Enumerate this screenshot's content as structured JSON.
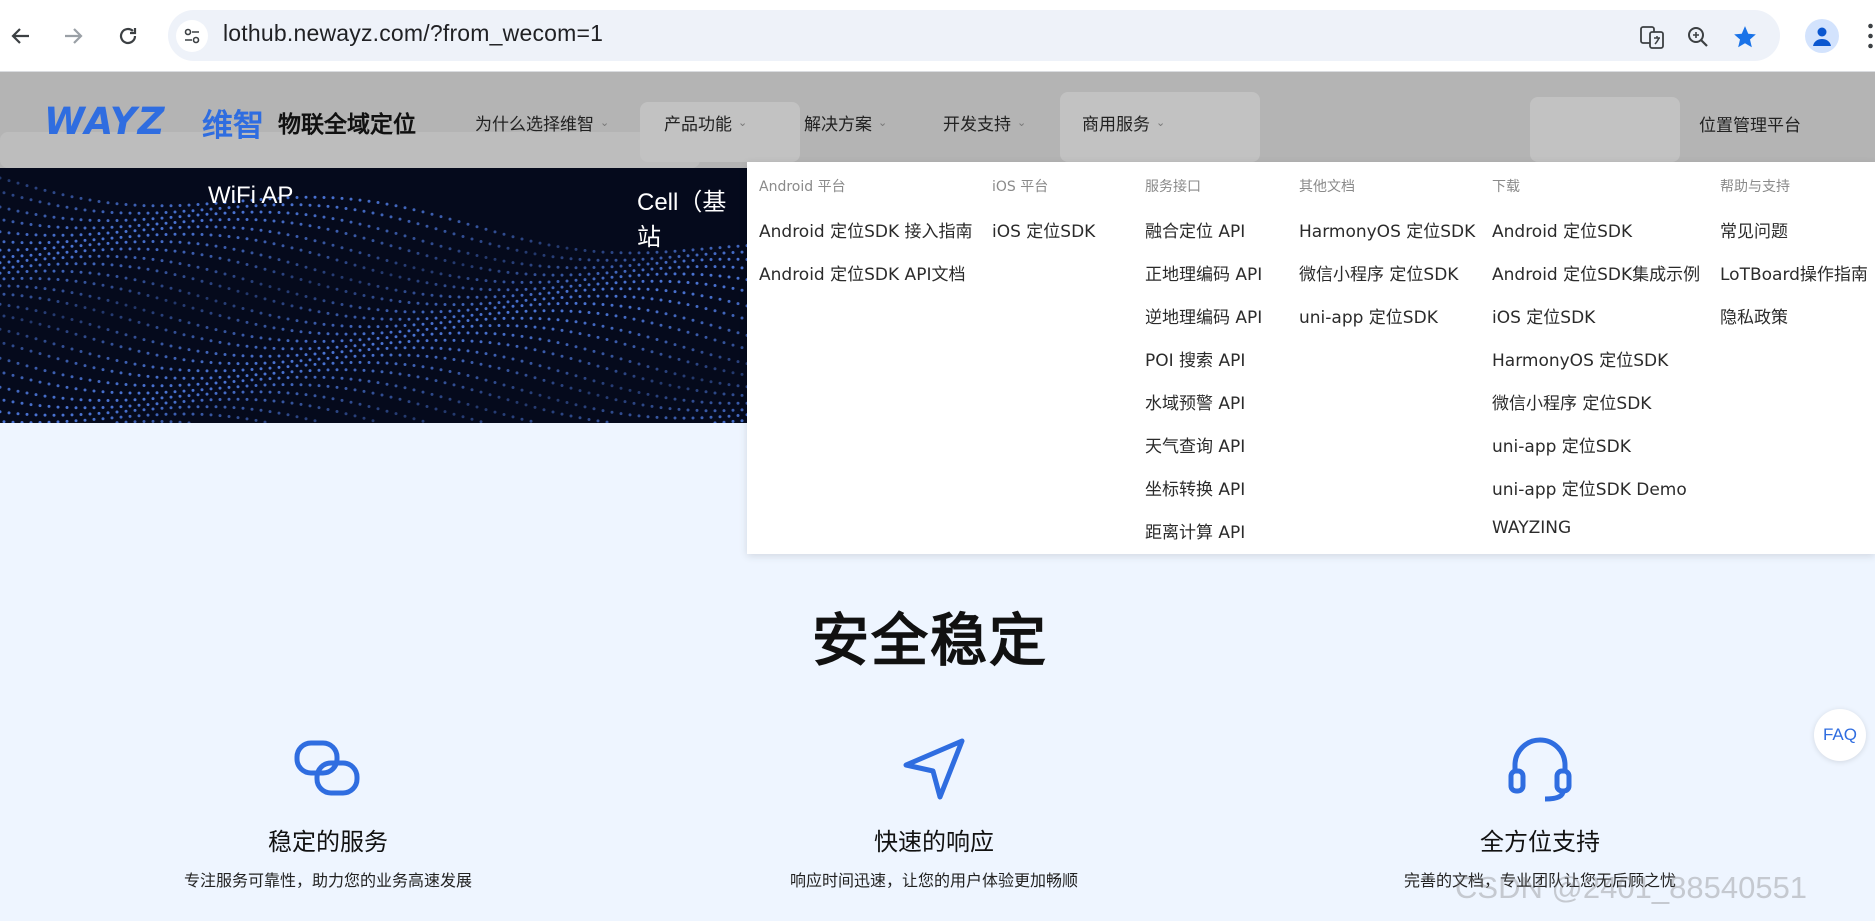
{
  "browser": {
    "url": "lothub.newayz.com/?from_wecom=1"
  },
  "header": {
    "logo_text": "WAYZ",
    "logo_cn": "维智",
    "logo_tagline": "物联全域定位",
    "nav": [
      {
        "label": "为什么选择维智"
      },
      {
        "label": "产品功能"
      },
      {
        "label": "解决方案"
      },
      {
        "label": "开发支持"
      },
      {
        "label": "商用服务"
      }
    ],
    "right_link": "位置管理平台"
  },
  "hero": {
    "labels": [
      "WiFi AP",
      "Cell（基站"
    ]
  },
  "dropdown": {
    "columns": [
      {
        "heading": "Android 平台",
        "links": [
          "Android 定位SDK 接入指南",
          "Android 定位SDK API文档"
        ]
      },
      {
        "heading": "iOS 平台",
        "links": [
          "iOS 定位SDK"
        ]
      },
      {
        "heading": "服务接口",
        "links": [
          "融合定位 API",
          "正地理编码 API",
          "逆地理编码 API",
          "POI 搜索 API",
          "水域预警 API",
          "天气查询 API",
          "坐标转换 API",
          "距离计算 API"
        ]
      },
      {
        "heading": "其他文档",
        "links": [
          "HarmonyOS 定位SDK",
          "微信小程序 定位SDK",
          "uni-app 定位SDK"
        ]
      },
      {
        "heading": "下载",
        "links": [
          "Android 定位SDK",
          "Android 定位SDK集成示例",
          "iOS 定位SDK",
          "HarmonyOS 定位SDK",
          "微信小程序 定位SDK",
          "uni-app 定位SDK",
          "uni-app 定位SDK Demo",
          "WAYZING"
        ]
      },
      {
        "heading": "帮助与支持",
        "links": [
          "常见问题",
          "LoTBoard操作指南",
          "隐私政策"
        ]
      }
    ]
  },
  "section": {
    "title": "安全稳定",
    "features": [
      {
        "icon": "link-icon",
        "title": "稳定的服务",
        "desc": "专注服务可靠性，助力您的业务高速发展"
      },
      {
        "icon": "navigation-arrow-icon",
        "title": "快速的响应",
        "desc": "响应时间迅速，让您的用户体验更加畅顺"
      },
      {
        "icon": "headset-icon",
        "title": "全方位支持",
        "desc": "完善的文档，专业团队让您无后顾之忧"
      }
    ]
  },
  "faq_label": "FAQ",
  "watermark": "CSDN @2401_88540551",
  "colors": {
    "brand_blue": "#2f6de0",
    "header_bg": "#b4b4b4",
    "page_bg": "#eef5ff",
    "hero_bg": "#050a1c"
  }
}
